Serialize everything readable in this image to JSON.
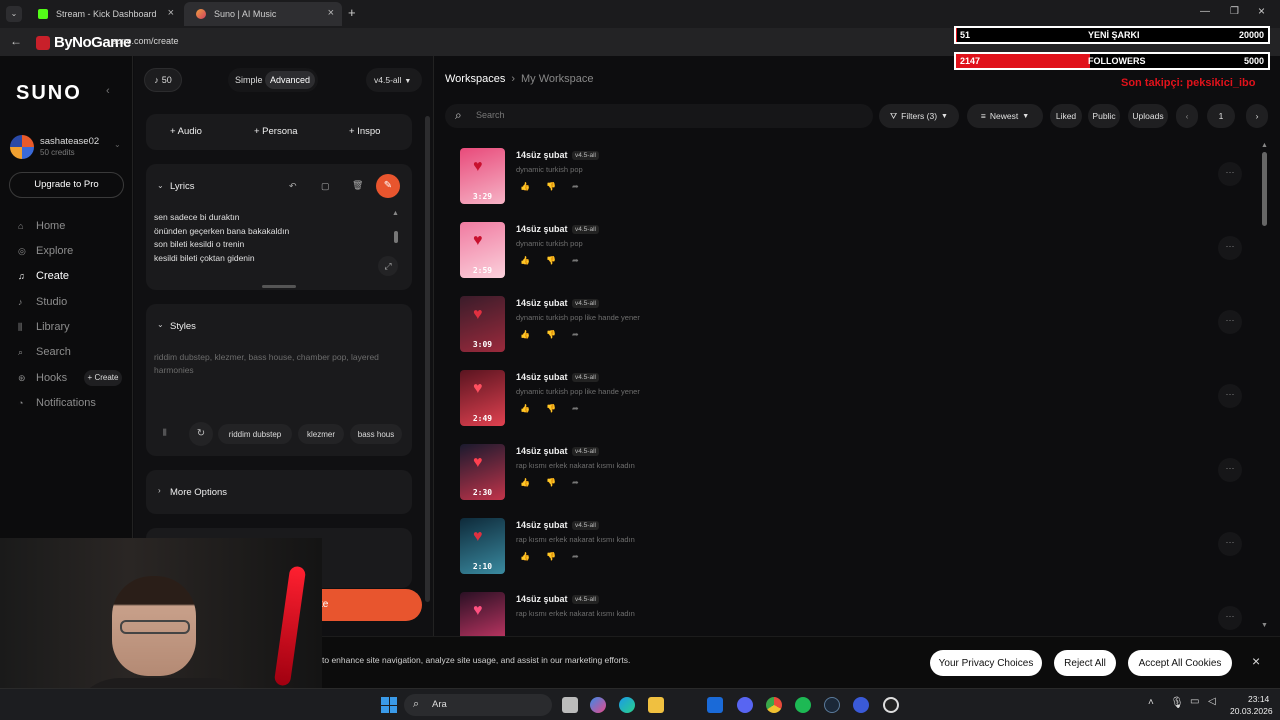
{
  "browser": {
    "tabs": [
      {
        "label": "Stream - Kick Dashboard"
      },
      {
        "label": "Suno | AI Music"
      }
    ],
    "url": "suno.com/create",
    "watermark": "ByNoGame"
  },
  "sidebar": {
    "logo": "SUNO",
    "user": {
      "name": "sashatease02",
      "credits": "50 credits"
    },
    "upgrade_label": "Upgrade to Pro",
    "nav": [
      {
        "label": "Home",
        "icon": "home-icon"
      },
      {
        "label": "Explore",
        "icon": "compass-icon"
      },
      {
        "label": "Create",
        "icon": "music-note-icon"
      },
      {
        "label": "Studio",
        "icon": "studio-icon"
      },
      {
        "label": "Library",
        "icon": "library-icon"
      },
      {
        "label": "Search",
        "icon": "search-icon"
      },
      {
        "label": "Hooks",
        "icon": "hooks-icon"
      },
      {
        "label": "Notifications",
        "icon": "bell-icon"
      }
    ],
    "hooks_create": "+ Create"
  },
  "create": {
    "credits_count": "50",
    "mode_simple": "Simple",
    "mode_advanced": "Advanced",
    "model": "v4.5-all",
    "add_buttons": [
      "+ Audio",
      "+ Persona",
      "+ Inspo"
    ],
    "lyrics_title": "Lyrics",
    "lyrics": [
      "sen sadece bi duraktın",
      "önünden geçerken bana bakakaldın",
      "son bileti kesildi o trenin",
      "kesildi bileti çoktan gidenin"
    ],
    "styles_title": "Styles",
    "styles_text": "riddim dubstep, klezmer, bass house, chamber pop, layered harmonies",
    "style_chips": [
      "riddim dubstep",
      "klezmer",
      "bass hous"
    ],
    "more_options": "More Options",
    "create_button": "te"
  },
  "main": {
    "breadcrumb": [
      "Workspaces",
      "My Workspace"
    ],
    "search_placeholder": "Search",
    "filters": "Filters (3)",
    "sort": "Newest",
    "liked": "Liked",
    "public": "Public",
    "uploads": "Uploads",
    "page": "1",
    "songs": [
      {
        "title": "14süz şubat",
        "version": "v4.5-all",
        "desc": "dynamic turkish pop",
        "duration": "3:29",
        "c1": "#e84a7a",
        "c2": "#f6b3c6"
      },
      {
        "title": "14süz şubat",
        "version": "v4.5-all",
        "desc": "dynamic turkish pop",
        "duration": "2:59",
        "c1": "#f07aa0",
        "c2": "#fbd1dc"
      },
      {
        "title": "14süz şubat",
        "version": "v4.5-all",
        "desc": "dynamic turkish pop like hande yener",
        "duration": "3:09",
        "c1": "#3a1c2a",
        "c2": "#9b2a3c"
      },
      {
        "title": "14süz şubat",
        "version": "v4.5-all",
        "desc": "dynamic turkish pop like hande yener",
        "duration": "2:49",
        "c1": "#5a1420",
        "c2": "#e04150"
      },
      {
        "title": "14süz şubat",
        "version": "v4.5-all",
        "desc": "rap kısmı erkek nakarat kısmı kadın",
        "duration": "2:30",
        "c1": "#1a1a2e",
        "c2": "#c2344a"
      },
      {
        "title": "14süz şubat",
        "version": "v4.5-all",
        "desc": "rap kısmı erkek nakarat kısmı kadın",
        "duration": "2:10",
        "c1": "#0e2a3a",
        "c2": "#3a8aa0"
      },
      {
        "title": "14süz şubat",
        "version": "v4.5-all",
        "desc": "rap kısmı erkek nakarat kısmı kadın",
        "duration": "",
        "c1": "#2a1024",
        "c2": "#d03a6a"
      }
    ]
  },
  "cookie": {
    "text": "to enhance site navigation, analyze site usage, and assist in our marketing efforts.",
    "privacy": "Your Privacy Choices",
    "reject": "Reject All",
    "accept": "Accept All Cookies"
  },
  "overlay": {
    "row1_left": "51",
    "row1_mid": "YENİ ŞARKI",
    "row1_right": "20000",
    "row1_progress": 0.0026,
    "row2_left": "2147",
    "row2_mid": "FOLLOWERS",
    "row2_right": "5000",
    "row2_progress": 0.43,
    "last_follower": "Son takipçi: peksikici_ibo"
  },
  "taskbar": {
    "search": "Ara",
    "time": "23:14",
    "date": "20.03.2026"
  },
  "colors": {
    "accent": "#e8552e",
    "overlay_red": "#e0121b",
    "background": "#0d0d0f"
  }
}
